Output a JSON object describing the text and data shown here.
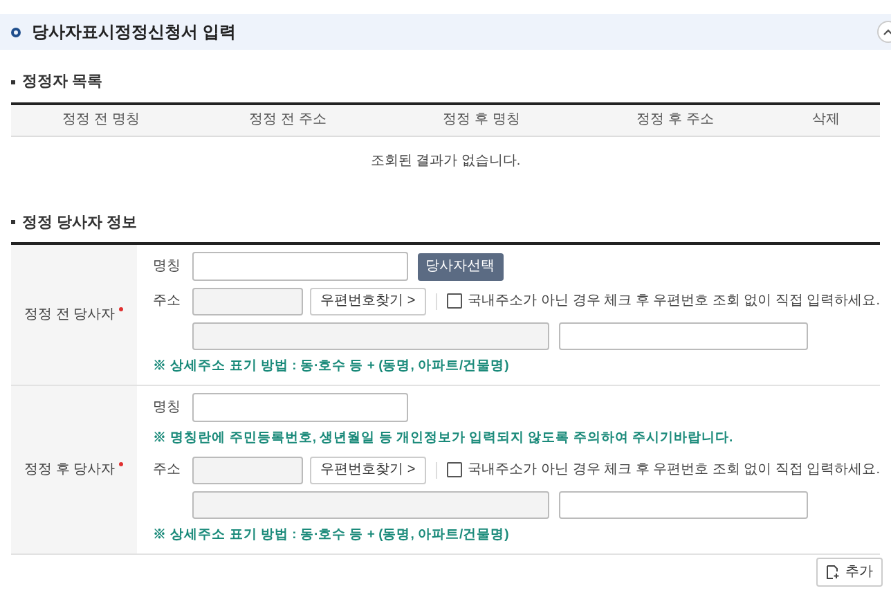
{
  "header": {
    "title": "당사자표시정정신청서 입력"
  },
  "list_section": {
    "title": "정정자 목록",
    "columns": [
      "정정 전 명칭",
      "정정 전 주소",
      "정정 후 명칭",
      "정정 후 주소",
      "삭제"
    ],
    "empty_message": "조회된 결과가 없습니다."
  },
  "info_section": {
    "title": "정정 당사자 정보",
    "parties": [
      {
        "label": "정정 전 당사자",
        "required": true,
        "name_label": "명칭",
        "select_button": "당사자선택",
        "address_label": "주소",
        "zip_button": "우편번호찾기 >",
        "foreign_checkbox": {
          "label": "국내주소가 아닌 경우 체크 후 우편번호 조회 없이 직접 입력하세요.",
          "checked": false
        },
        "address_note": "※ 상세주소 표기 방법 : 동·호수 등 + (동명, 아파트/건물명)"
      },
      {
        "label": "정정 후 당사자",
        "required": true,
        "name_label": "명칭",
        "name_note": "※ 명칭란에 주민등록번호, 생년월일 등 개인정보가 입력되지 않도록 주의하여 주시기바랍니다.",
        "address_label": "주소",
        "zip_button": "우편번호찾기 >",
        "foreign_checkbox": {
          "label": "국내주소가 아닌 경우 체크 후 우편번호 조회 없이 직접 입력하세요.",
          "checked": false
        },
        "address_note": "※ 상세주소 표기 방법 : 동·호수 등 + (동명, 아파트/건물명)"
      }
    ]
  },
  "add_button": "추가"
}
